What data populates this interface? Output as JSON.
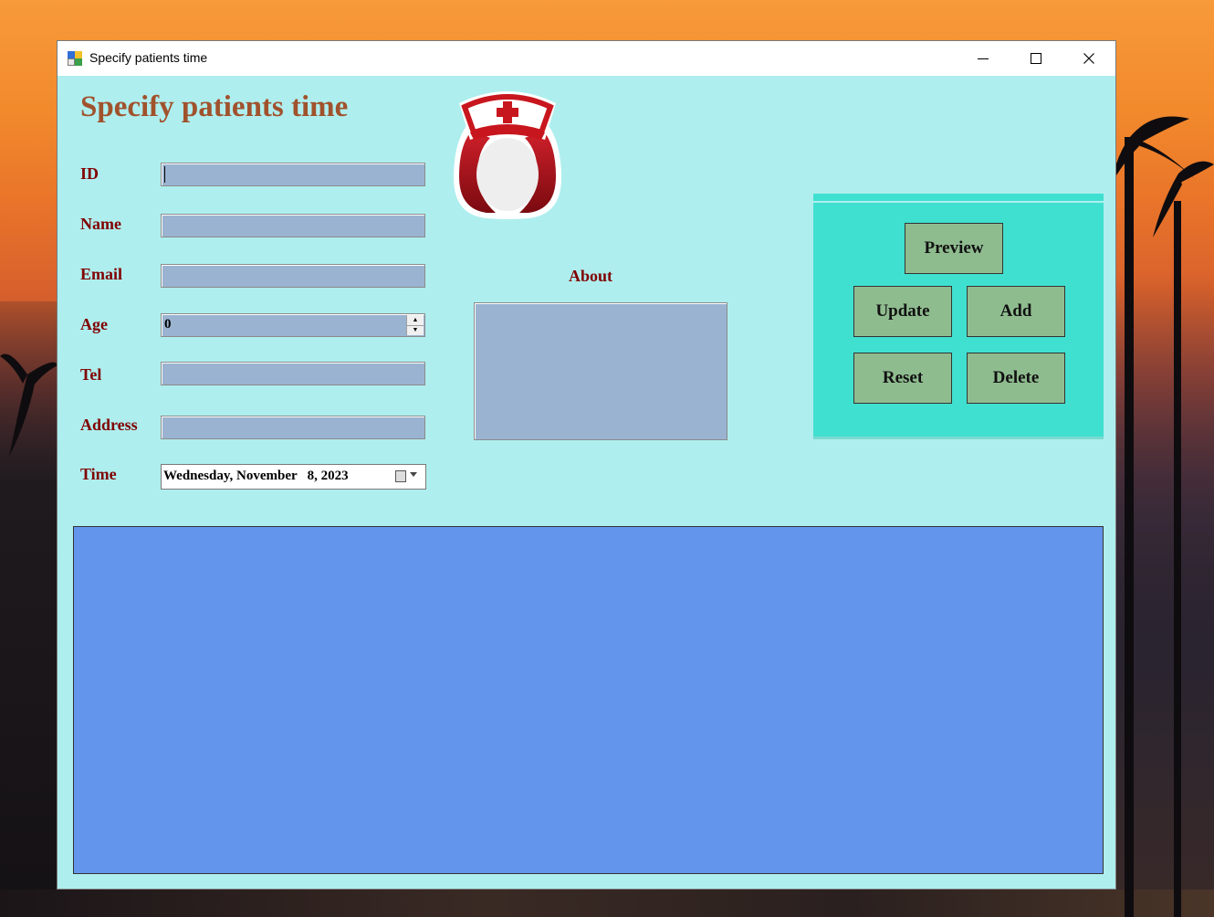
{
  "window": {
    "title": "Specify patients time"
  },
  "form": {
    "heading": "Specify patients time",
    "labels": {
      "id": "ID",
      "name": "Name",
      "email": "Email",
      "age": "Age",
      "tel": "Tel",
      "address": "Address",
      "time": "Time",
      "about": "About"
    },
    "values": {
      "id": "",
      "name": "",
      "email": "",
      "age": "0",
      "tel": "",
      "address": "",
      "time": "Wednesday, November   8, 2023",
      "about": ""
    }
  },
  "actions": {
    "preview": "Preview",
    "update": "Update",
    "add": "Add",
    "reset": "Reset",
    "delete": "Delete"
  },
  "icons": {
    "logo": "nurse-icon",
    "calendar": "calendar-icon",
    "app": "app-icon"
  },
  "colors": {
    "form_bg": "#afeeee",
    "panel_bg": "#40e0d0",
    "button_bg": "#8fbc8f",
    "grid_bg": "#6495ed",
    "input_bg": "#9ab3d1",
    "label_color": "#800000",
    "heading_color": "#a0522d"
  }
}
